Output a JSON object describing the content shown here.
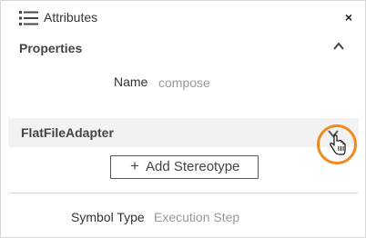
{
  "header": {
    "title": "Attributes",
    "close_label": "×",
    "icon": "list-icon"
  },
  "properties": {
    "title": "Properties",
    "expanded": true,
    "name_label": "Name",
    "name_value": "compose"
  },
  "adapter": {
    "title": "FlatFileAdapter",
    "expanded": false
  },
  "stereotype_button": {
    "plus": "+",
    "label": "Add Stereotype"
  },
  "symbol": {
    "label": "Symbol Type",
    "value": "Execution Step"
  },
  "colors": {
    "highlight": "#ee8a1e",
    "row_background": "#f2f2f2"
  }
}
